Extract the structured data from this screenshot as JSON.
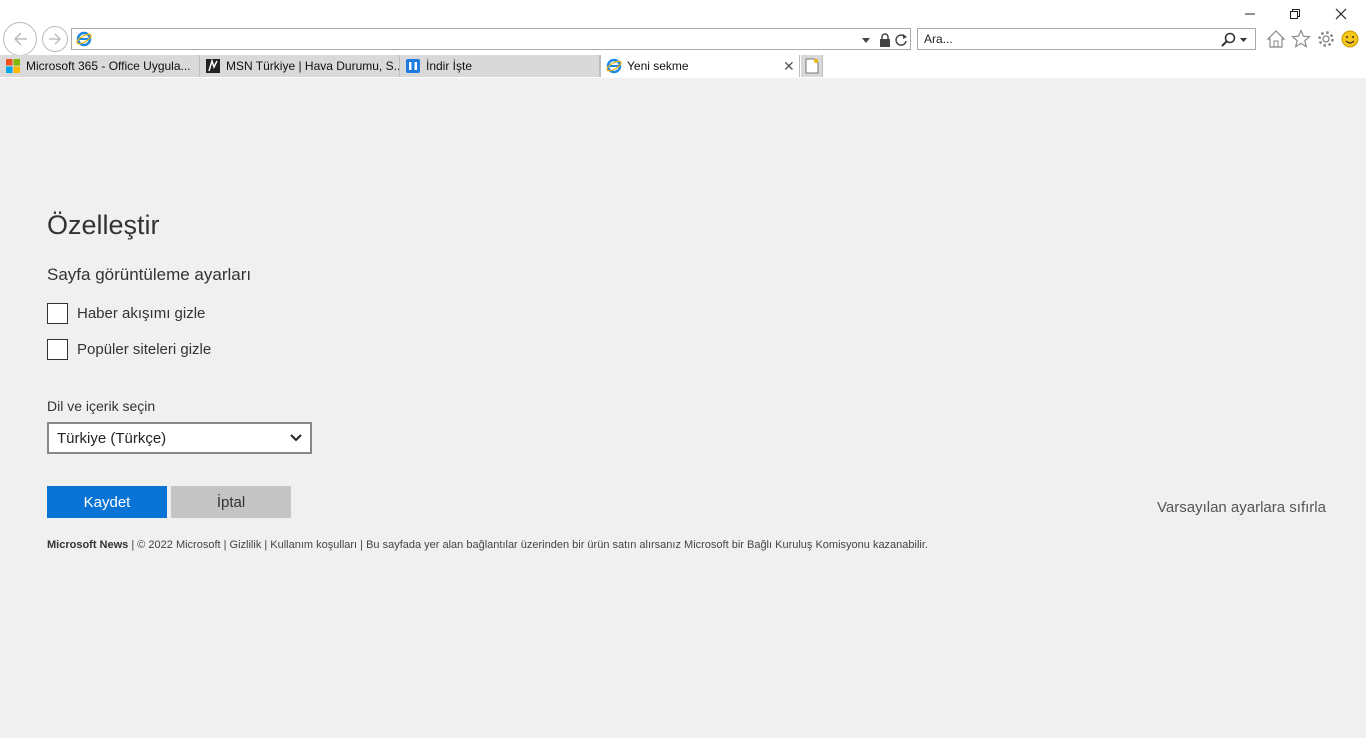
{
  "browser": {
    "address_value": "",
    "search_placeholder": "Ara...",
    "tabs": [
      {
        "label": "Microsoft 365 - Office Uygula...",
        "icon": "microsoft-logo-icon"
      },
      {
        "label": "MSN Türkiye | Hava Durumu, S...",
        "icon": "msn-logo-icon"
      },
      {
        "label": "İndir İşte",
        "icon": "indir-logo-icon"
      },
      {
        "label": "Yeni sekme",
        "icon": "ie-logo-icon"
      }
    ],
    "active_tab": 3
  },
  "page": {
    "title": "Özelleştir",
    "section_title": "Sayfa görüntüleme ayarları",
    "options": [
      {
        "label": "Haber akışımı gizle",
        "checked": false
      },
      {
        "label": "Popüler siteleri gizle",
        "checked": false
      }
    ],
    "language_label": "Dil ve içerik seçin",
    "language_value": "Türkiye (Türkçe)",
    "save_label": "Kaydet",
    "cancel_label": "İptal",
    "reset_label": "Varsayılan ayarlara sıfırla"
  },
  "footer": {
    "brand": "Microsoft News",
    "text": " | © 2022 Microsoft | Gizlilik | Kullanım koşulları | Bu sayfada yer alan bağlantılar üzerinden bir ürün satın alırsanız Microsoft bir Bağlı Kuruluş Komisyonu kazanabilir."
  },
  "colors": {
    "accent": "#0a74d6",
    "background": "#f0f0f0",
    "cancel": "#c4c4c4"
  }
}
